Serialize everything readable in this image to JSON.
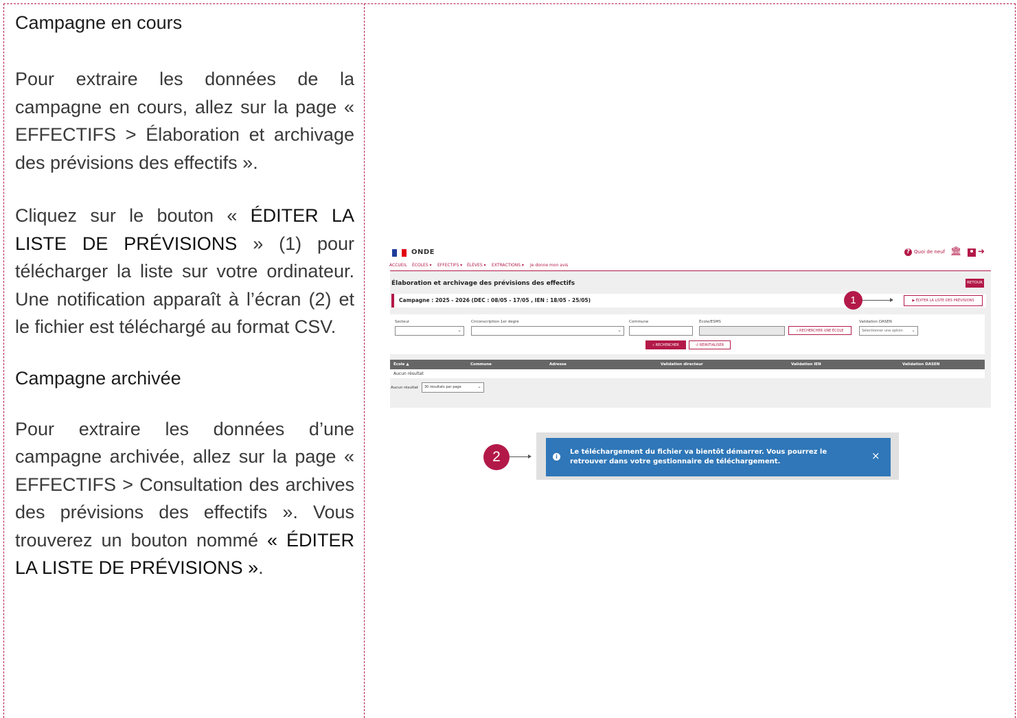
{
  "left": {
    "heading1": "Campagne en cours",
    "p1": "Pour extraire les données de la campagne en cours, allez sur la page « EFFECTIFS > Élaboration et archivage des prévisions des effectifs ».",
    "p2_a": "Cliquez sur le bouton « ",
    "p2_em": "ÉDITER LA LISTE DE PRÉVISIONS",
    "p2_b": " » (1) pour télécharger la liste sur votre ordinateur. Une notification apparaît à l’écran (2) et le fichier est téléchargé au format CSV.",
    "heading2": "Campagne archivée",
    "p3_a": "Pour extraire les données d’une campagne archivée, allez sur la page « EFFECTIFS > Consultation des archives des prévisions des effectifs ». Vous trouverez un bouton nommé ",
    "p3_em": "« ÉDITER LA LISTE DE PRÉVISIONS »",
    "p3_b": "."
  },
  "app": {
    "brand": "ONDE",
    "whats_new": "Quoi de neuf",
    "nav": [
      "ACCUEIL",
      "ÉCOLES ▾",
      "EFFECTIFS ▾",
      "ÉLÈVES ▾",
      "EXTRACTIONS ▾",
      "Je donne mon avis"
    ],
    "page_title": "Élaboration et archivage des prévisions des effectifs",
    "back_button": "RETOUR",
    "campaign": "Campagne : 2025 - 2026 (DEC : 08/05 - 17/05 , IEN : 18/05 - 25/05)",
    "edit_button": "ÉDITER LA LISTE DES PRÉVISIONS",
    "filters": {
      "secteur": "Secteur",
      "circonscription": "Circonscription 1er degré",
      "commune": "Commune",
      "ecole": "École/ESMS",
      "validation": "Validation DASEN",
      "search_school_button": "RECHERCHER UNE ÉCOLE",
      "select_placeholder": "Sélectionner une option",
      "search_button": "RECHERCHER",
      "reset_button": "RÉINITIALISER"
    },
    "table": {
      "columns": [
        "École ▲",
        "Commune",
        "Adresse",
        "Validation directeur",
        "Validation IEN",
        "Validation DASEN"
      ],
      "empty": "Aucun résultat"
    },
    "pager_label": "Aucun résultat",
    "pager_select": "30 résultats par page"
  },
  "notification": {
    "message": "Le téléchargement du fichier va bientôt démarrer. Vous pourrez le retrouver dans votre gestionnaire de téléchargement.",
    "close": "×"
  },
  "markers": {
    "one": "1",
    "two": "2"
  },
  "colors": {
    "accent": "#b31948",
    "notification": "#2f77b8"
  }
}
